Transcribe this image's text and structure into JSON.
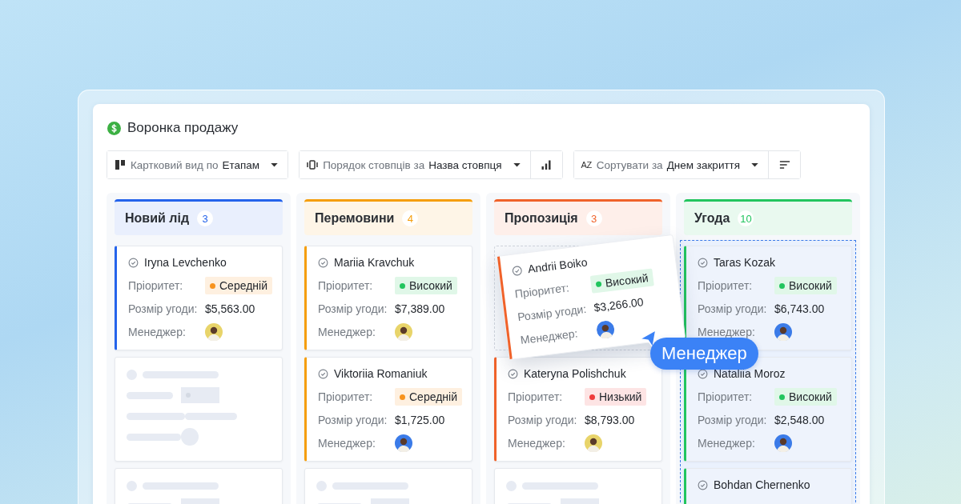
{
  "title": "Воронка продажу",
  "controls": [
    {
      "kind": "view",
      "label": "Картковий вид по",
      "value": "Етапам"
    },
    {
      "kind": "order",
      "label": "Порядок стовпців за",
      "value": "Назва стовпця"
    },
    {
      "kind": "sort",
      "icon_text": "AZ",
      "label": "Сортувати за",
      "value": "Днем закриття"
    }
  ],
  "columns": [
    {
      "title": "Новий лід",
      "count": "3",
      "color": "#2463eb",
      "drop_target": false,
      "cards": [
        {
          "kind": "deal",
          "name": "Iryna Levchenko",
          "priority": {
            "label": "Пріоритет:",
            "value": "Середній",
            "color": "#f7931e"
          },
          "deal_size": {
            "label": "Розмір угоди:",
            "value": "$5,563.00"
          },
          "manager": {
            "label": "Менеджер:",
            "color": "#e8d46a"
          }
        },
        {
          "kind": "skeleton"
        },
        {
          "kind": "skeleton"
        }
      ]
    },
    {
      "title": "Перемовини",
      "count": "4",
      "color": "#f59e0b",
      "drop_target": false,
      "cards": [
        {
          "kind": "deal",
          "name": "Mariia Kravchuk",
          "priority": {
            "label": "Пріоритет:",
            "value": "Високий",
            "color": "#22c55e"
          },
          "deal_size": {
            "label": "Розмір угоди:",
            "value": "$7,389.00"
          },
          "manager": {
            "label": "Менеджер:",
            "color": "#e8d46a"
          }
        },
        {
          "kind": "deal",
          "name": "Viktoriia Romaniuk",
          "priority": {
            "label": "Пріоритет:",
            "value": "Середній",
            "color": "#f7931e"
          },
          "deal_size": {
            "label": "Розмір угоди:",
            "value": "$1,725.00"
          },
          "manager": {
            "label": "Менеджер:",
            "color": "#3b7be8"
          }
        },
        {
          "kind": "skeleton"
        }
      ]
    },
    {
      "title": "Пропозиція",
      "count": "3",
      "color": "#f0622a",
      "drop_target": false,
      "cards": [
        {
          "kind": "slot"
        },
        {
          "kind": "deal",
          "name": "Kateryna Polishchuk",
          "priority": {
            "label": "Пріоритет:",
            "value": "Низький",
            "color": "#ef3b3b"
          },
          "deal_size": {
            "label": "Розмір угоди:",
            "value": "$8,793.00"
          },
          "manager": {
            "label": "Менеджер:",
            "color": "#e8d46a"
          }
        },
        {
          "kind": "skeleton"
        }
      ]
    },
    {
      "title": "Угода",
      "count": "10",
      "color": "#22c55e",
      "drop_target": true,
      "cards": [
        {
          "kind": "deal",
          "name": "Taras Kozak",
          "priority": {
            "label": "Пріоритет:",
            "value": "Високий",
            "color": "#22c55e"
          },
          "deal_size": {
            "label": "Розмір угоди:",
            "value": "$6,743.00"
          },
          "manager": {
            "label": "Менеджер:",
            "color": "#3b7be8"
          }
        },
        {
          "kind": "deal",
          "name": "Nataliia Moroz",
          "priority": {
            "label": "Пріоритет:",
            "value": "Високий",
            "color": "#22c55e"
          },
          "deal_size": {
            "label": "Розмір угоди:",
            "value": "$2,548.00"
          },
          "manager": {
            "label": "Менеджер:",
            "color": "#3b7be8"
          }
        },
        {
          "kind": "deal",
          "name": "Bohdan Chernenko"
        }
      ]
    }
  ],
  "dragged_card": {
    "color": "#f0622a",
    "name": "Andrii Boiko",
    "priority": {
      "label": "Пріоритет:",
      "value": "Високий",
      "color": "#22c55e"
    },
    "deal_size": {
      "label": "Розмір угоди:",
      "value": "$3,266.00"
    },
    "manager": {
      "label": "Менеджер:",
      "color": "#3b7be8"
    }
  },
  "cursor_label": "Менеджер"
}
